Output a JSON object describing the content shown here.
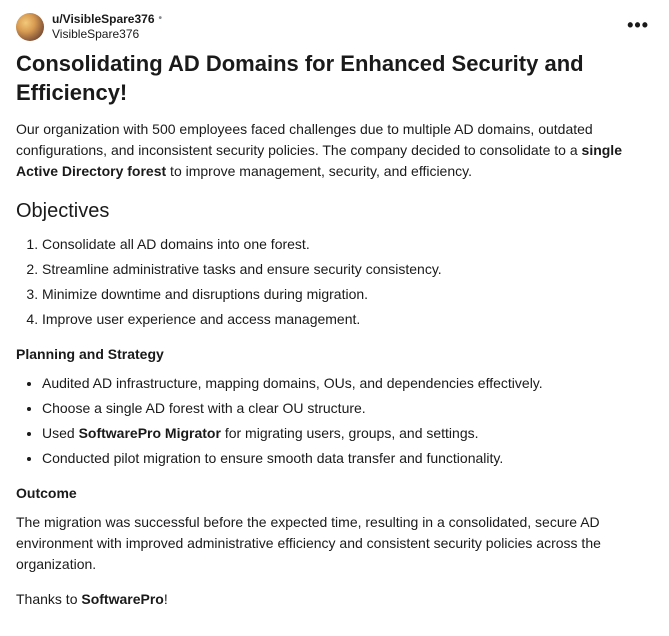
{
  "header": {
    "user_prefix": "u/VisibleSpare376",
    "dot": "•",
    "subline": "VisibleSpare376",
    "more": "•••"
  },
  "title": "Consolidating AD Domains for Enhanced Security and Efficiency!",
  "intro_pre": "Our organization with 500 employees faced challenges due to multiple AD domains, outdated configurations, and inconsistent security policies. The company decided to consolidate to a ",
  "intro_strong": "single Active Directory forest",
  "intro_post": " to improve management, security, and efficiency.",
  "objectives_heading": "Objectives",
  "objectives": [
    "Consolidate all AD domains into one forest.",
    "Streamline administrative tasks and ensure security consistency.",
    "Minimize downtime and disruptions during migration.",
    "Improve user experience and access management."
  ],
  "planning_heading": "Planning and Strategy",
  "planning": {
    "item1": "Audited AD infrastructure, mapping domains, OUs, and dependencies effectively.",
    "item2": "Choose a single AD forest with a clear OU structure.",
    "item3_pre": "Used ",
    "item3_strong": "SoftwarePro Migrator",
    "item3_post": " for migrating users, groups, and settings.",
    "item4": "Conducted pilot migration to ensure smooth data transfer and functionality."
  },
  "outcome_heading": "Outcome",
  "outcome_body": "The migration was successful before the expected time, resulting in a consolidated, secure AD environment with improved administrative efficiency and consistent security policies across the organization.",
  "thanks_pre": "Thanks to ",
  "thanks_strong": "SoftwarePro",
  "thanks_post": "!"
}
